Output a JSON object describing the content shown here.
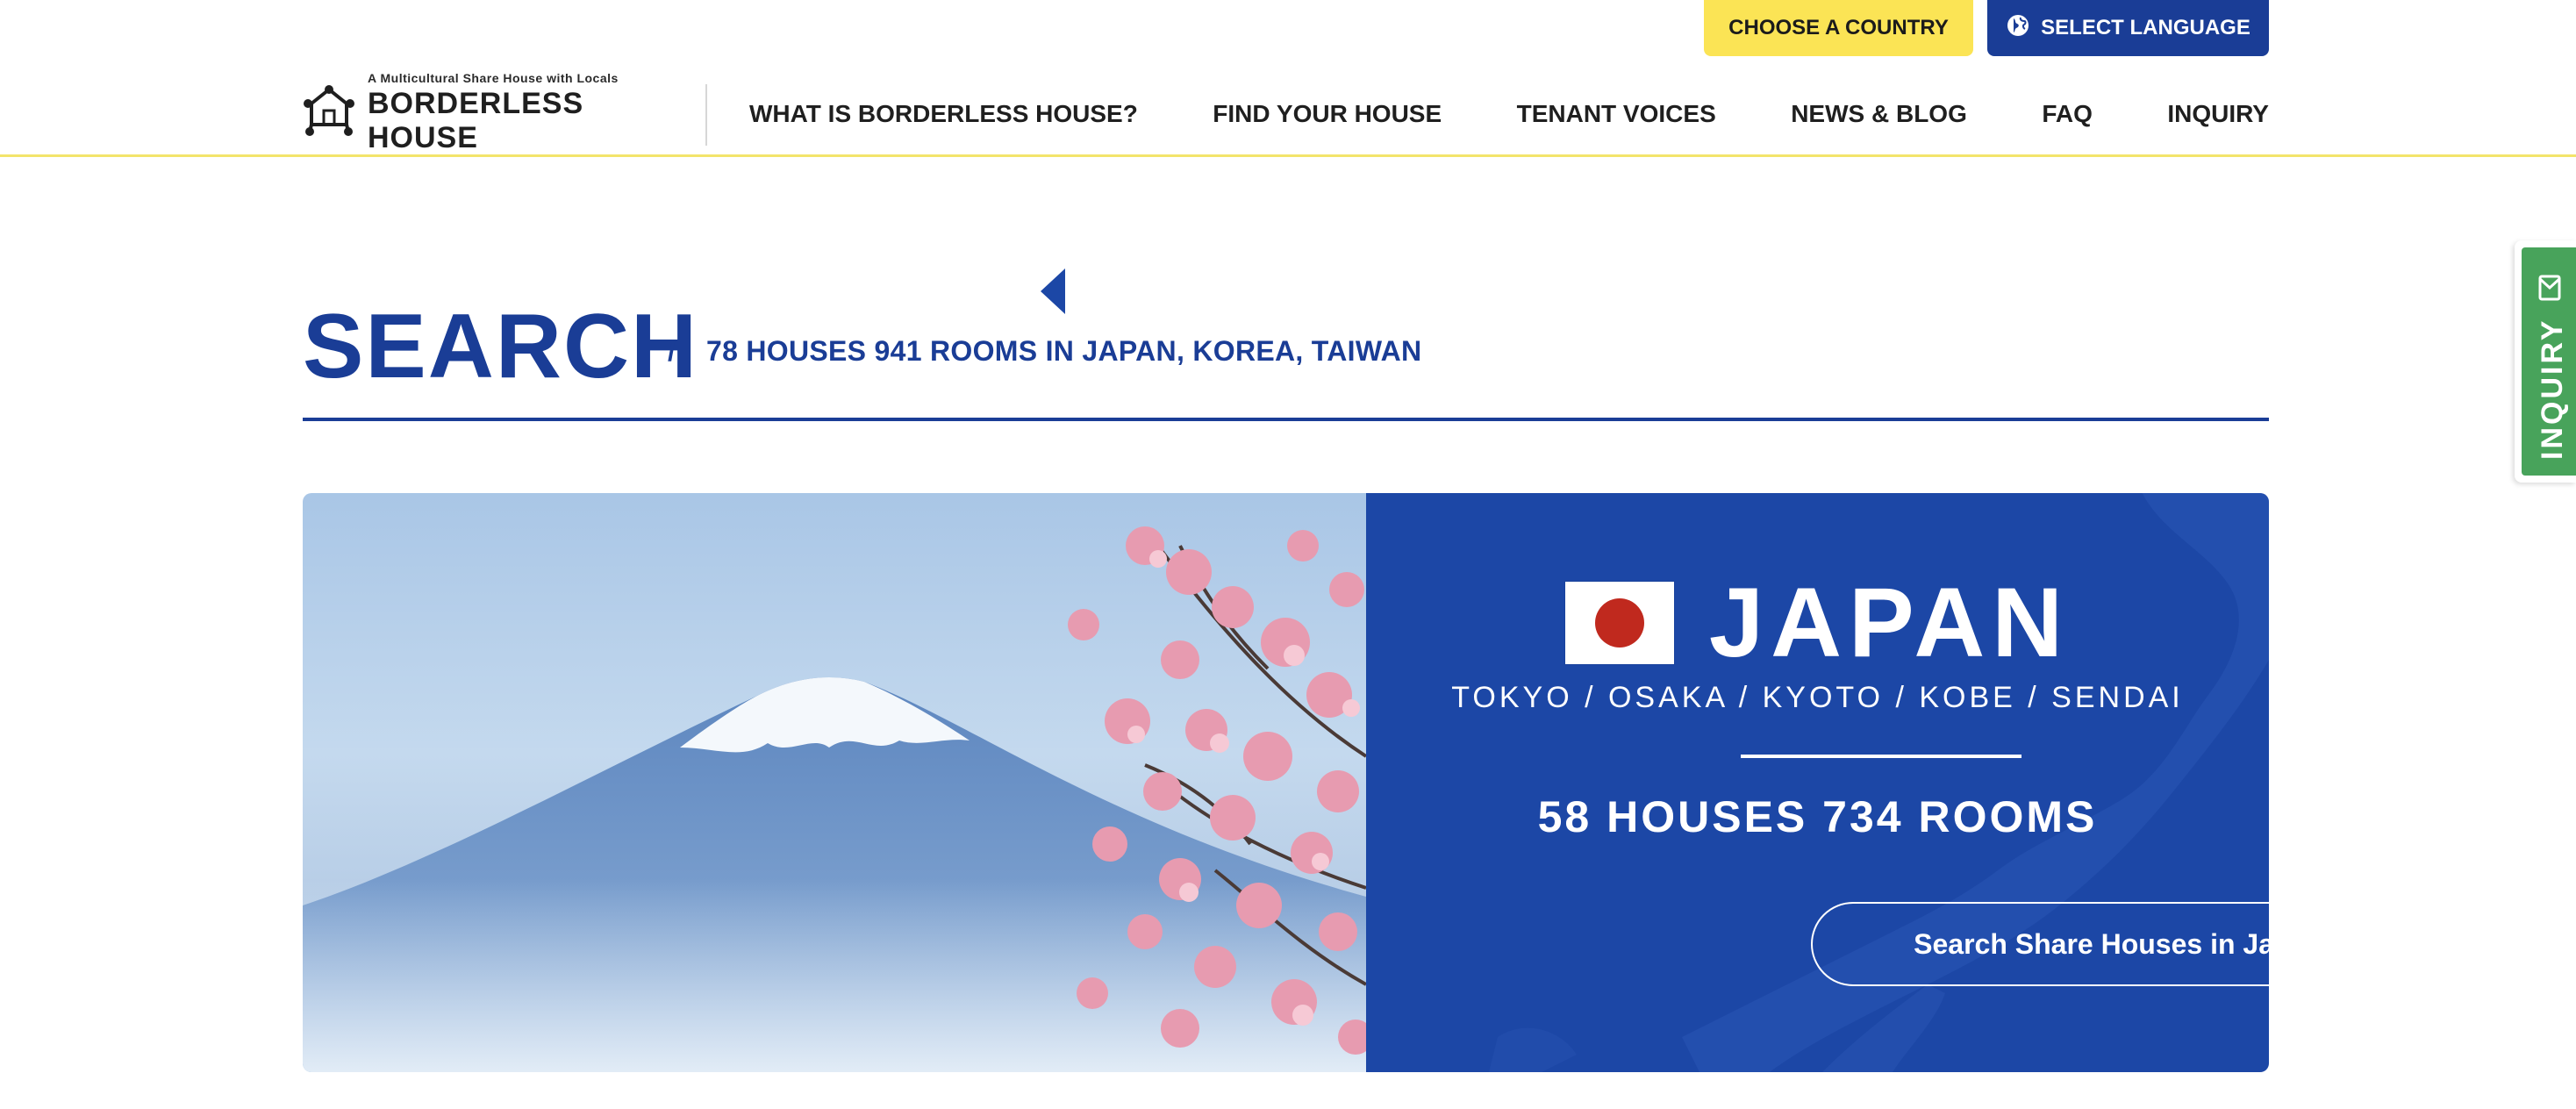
{
  "topbar": {
    "country_button": "CHOOSE A COUNTRY",
    "language_button": "SELECT LANGUAGE"
  },
  "header": {
    "logo_tagline": "A Multicultural Share House with Locals",
    "logo_name": "BORDERLESS HOUSE",
    "nav": [
      {
        "label": "WHAT IS BORDERLESS HOUSE?"
      },
      {
        "label": "FIND YOUR HOUSE"
      },
      {
        "label": "TENANT VOICES"
      },
      {
        "label": "NEWS & BLOG"
      },
      {
        "label": "FAQ"
      },
      {
        "label": "INQUIRY"
      }
    ]
  },
  "search": {
    "title": "SEARCH",
    "separator": "/",
    "summary": "78 HOUSES 941 ROOMS IN JAPAN, KOREA, TAIWAN"
  },
  "country_card": {
    "country": "JAPAN",
    "cities": "TOKYO / OSAKA / KYOTO / KOBE / SENDAI",
    "stats": "58 HOUSES 734 ROOMS",
    "cta_label": "Search Share Houses in Japan"
  },
  "side_tab": {
    "label": "INQUIRY"
  },
  "colors": {
    "brand_blue": "#1a3d96",
    "panel_blue": "#1c47a6",
    "accent_yellow": "#fbe455",
    "inquiry_green": "#48a35b",
    "flag_red": "#c0291e"
  },
  "icons": [
    "globe-icon",
    "share-house-logo-icon",
    "chevron-right-icon",
    "mail-icon"
  ]
}
